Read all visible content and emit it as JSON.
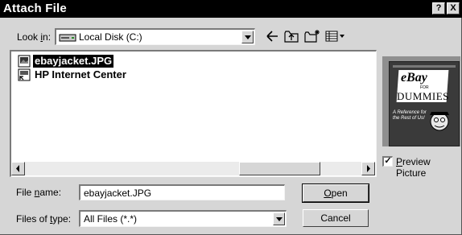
{
  "window": {
    "title": "Attach File",
    "help_label": "?",
    "close_label": "X"
  },
  "look_in": {
    "label_pre": "Look ",
    "label_accel": "i",
    "label_post": "n:",
    "value": "Local Disk (C:)"
  },
  "toolbar": {
    "icons": [
      "back-icon",
      "up-one-level-icon",
      "create-new-folder-icon",
      "view-menu-icon"
    ]
  },
  "files": {
    "items": [
      {
        "name": "ebayjacket.JPG",
        "icon": "image-file-icon",
        "selected": true
      },
      {
        "name": "HP Internet Center",
        "icon": "shortcut-file-icon",
        "selected": false
      }
    ]
  },
  "preview": {
    "checkbox_checked": true,
    "label_accel": "P",
    "label_rest": "review Picture",
    "book": {
      "brand": "eBay",
      "for": "FOR",
      "dummies": "DUMMIES",
      "reference": "A Reference for the Rest of Us!"
    }
  },
  "file_name": {
    "label_pre": "File ",
    "label_accel": "n",
    "label_post": "ame:",
    "value": "ebayjacket.JPG"
  },
  "files_of_type": {
    "label_pre": "Files of ",
    "label_accel": "t",
    "label_post": "ype:",
    "value": "All Files (*.*)"
  },
  "buttons": {
    "open_accel": "O",
    "open_rest": "pen",
    "cancel": "Cancel"
  }
}
